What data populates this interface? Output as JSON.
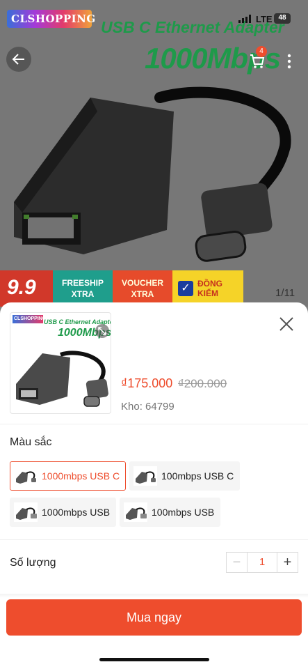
{
  "status_bar": {
    "network": "LTE",
    "battery": "48"
  },
  "hero": {
    "brand_logo": "CLSHOPPING",
    "title": "USB C Ethernet Adapter",
    "speed": "1000Mbps",
    "cart_badge": "4",
    "image_counter": "1/11",
    "promo": {
      "badge_99": "9.9",
      "freeship_line1": "FREESHIP",
      "freeship_line2": "XTRA",
      "voucher_line1": "VOUCHER",
      "voucher_line2": "XTRA",
      "check_line1": "ĐỒNG",
      "check_line2": "KIỂM"
    }
  },
  "sheet": {
    "thumb_logo": "CLSHOPPING",
    "thumb_title": "USB C Ethernet Adapter",
    "thumb_speed": "1000Mbps",
    "price_current": "₫175.000",
    "price_original": "₫200.000",
    "stock": "Kho: 64799",
    "color_label": "Màu sắc",
    "variants": [
      {
        "label": "1000mbps USB C",
        "selected": true
      },
      {
        "label": "100mbps USB C",
        "selected": false
      },
      {
        "label": "1000mbps USB",
        "selected": false
      },
      {
        "label": "100mbps USB",
        "selected": false
      }
    ],
    "quantity_label": "Số lượng",
    "quantity_value": "1",
    "quantity_minus": "−",
    "quantity_plus": "+",
    "buy_button": "Mua ngay"
  },
  "colors": {
    "accent": "#ee4d2d",
    "brand_green": "#1e9a4a"
  },
  "icons": [
    "back-arrow-icon",
    "cart-icon",
    "more-icon",
    "zoom-icon",
    "close-icon",
    "signal-icon",
    "battery-icon",
    "check-icon"
  ]
}
